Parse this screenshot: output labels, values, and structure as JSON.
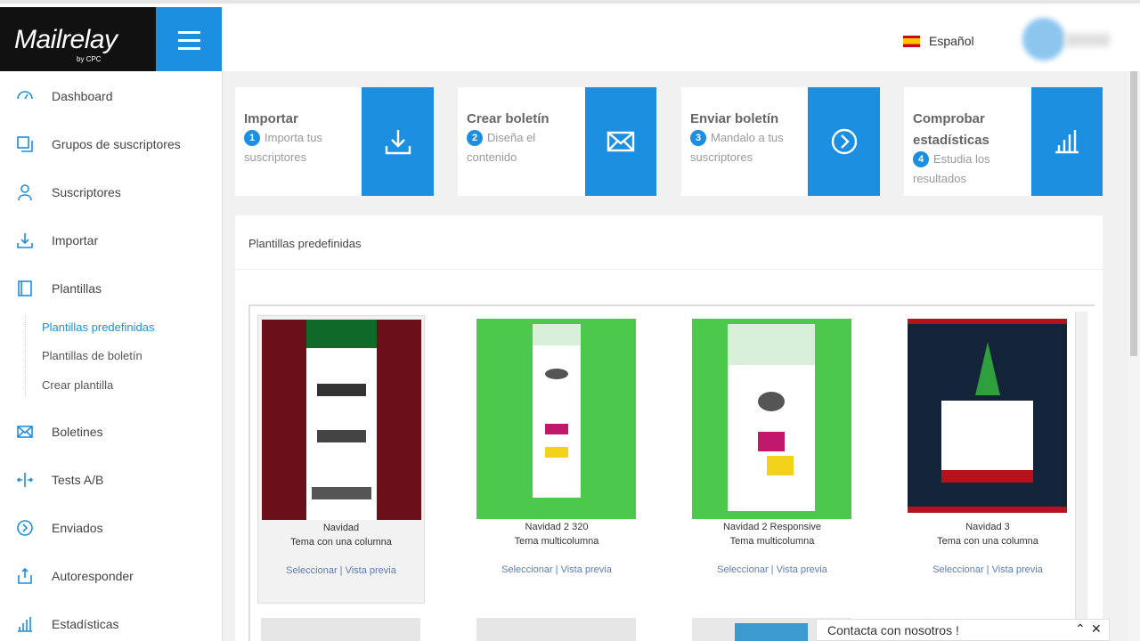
{
  "app": {
    "logo_text": "Mailrelay",
    "logo_sub": "by CPC",
    "language": "Español"
  },
  "sidebar": {
    "items": [
      {
        "label": "Dashboard",
        "icon": "dashboard-icon"
      },
      {
        "label": "Grupos de suscriptores",
        "icon": "groups-icon"
      },
      {
        "label": "Suscriptores",
        "icon": "user-icon"
      },
      {
        "label": "Importar",
        "icon": "download-icon"
      },
      {
        "label": "Plantillas",
        "icon": "template-icon"
      },
      {
        "label": "Boletines",
        "icon": "envelope-icon"
      },
      {
        "label": "Tests A/B",
        "icon": "split-icon"
      },
      {
        "label": "Enviados",
        "icon": "arrow-circle-icon"
      },
      {
        "label": "Autoresponder",
        "icon": "share-icon"
      },
      {
        "label": "Estadísticas",
        "icon": "bar-chart-icon"
      }
    ],
    "subitems": [
      {
        "label": "Plantillas predefinidas",
        "active": true
      },
      {
        "label": "Plantillas de boletín",
        "active": false
      },
      {
        "label": "Crear plantilla",
        "active": false
      }
    ]
  },
  "steps": [
    {
      "title": "Importar",
      "num": "1",
      "desc": "Importa tus suscriptores",
      "icon": "download-icon"
    },
    {
      "title": "Crear boletín",
      "num": "2",
      "desc": "Diseña el contenido",
      "icon": "envelope-icon"
    },
    {
      "title": "Enviar boletín",
      "num": "3",
      "desc": "Mandalo a tus suscriptores",
      "icon": "arrow-circle-icon"
    },
    {
      "title": "Comprobar estadísticas",
      "num": "4",
      "desc": "Estudia los resultados",
      "icon": "bar-chart-icon"
    }
  ],
  "templates": {
    "title": "Plantillas predefinidas",
    "items": [
      {
        "name": "Navidad",
        "desc": "Tema con una columna",
        "select": "Seleccionar",
        "preview": "Vista previa",
        "bg": "#6b0f1a",
        "selected": true
      },
      {
        "name": "Navidad 2 320",
        "desc": "Tema multicolumna",
        "select": "Seleccionar",
        "preview": "Vista previa",
        "bg": "#4cc94c",
        "selected": false
      },
      {
        "name": "Navidad 2 Responsive",
        "desc": "Tema multicolumna",
        "select": "Seleccionar",
        "preview": "Vista previa",
        "bg": "#4cc94c",
        "selected": false
      },
      {
        "name": "Navidad 3",
        "desc": "Tema con una columna",
        "select": "Seleccionar",
        "preview": "Vista previa",
        "bg": "#13243a",
        "selected": false
      }
    ]
  },
  "contact": {
    "label": "Contacta con nosotros !"
  },
  "colors": {
    "accent": "#1c8fe0",
    "logo_bg": "#111111"
  }
}
